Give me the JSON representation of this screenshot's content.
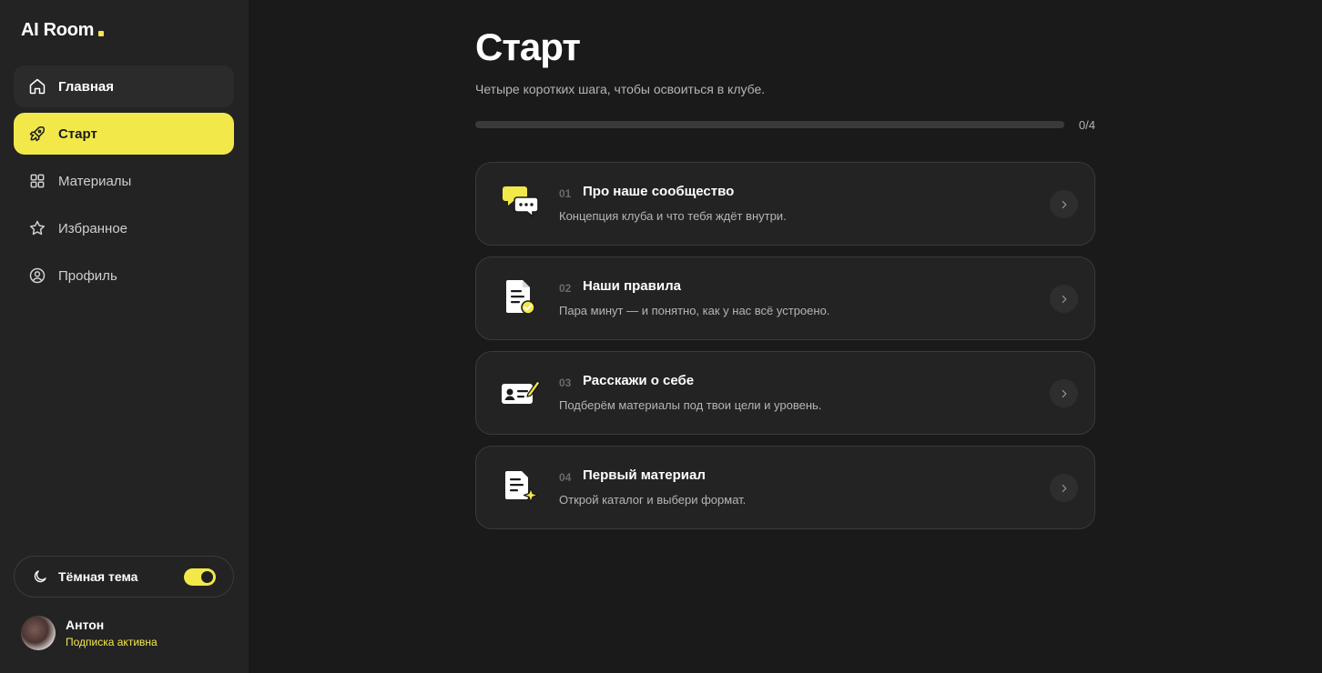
{
  "brand": {
    "name": "AI Room",
    "accent": "#f2e84a"
  },
  "sidebar": {
    "items": [
      {
        "label": "Главная",
        "icon": "home-icon"
      },
      {
        "label": "Старт",
        "icon": "rocket-icon"
      },
      {
        "label": "Материалы",
        "icon": "grid-icon"
      },
      {
        "label": "Избранное",
        "icon": "star-icon"
      },
      {
        "label": "Профиль",
        "icon": "user-circle-icon"
      }
    ],
    "theme_label": "Тёмная тема",
    "theme_on": true,
    "user": {
      "name": "Антон",
      "status": "Подписка активна"
    }
  },
  "main": {
    "title": "Старт",
    "subtitle": "Четыре коротких шага, чтобы освоиться в клубе.",
    "progress": {
      "done": 0,
      "total": 4,
      "label": "0/4"
    },
    "steps": [
      {
        "num": "01",
        "title": "Про наше сообщество",
        "desc": "Концепция клуба и что тебя ждёт внутри.",
        "icon": "chat-bubbles-icon"
      },
      {
        "num": "02",
        "title": "Наши правила",
        "desc": "Пара минут — и понятно, как у нас всё устроено.",
        "icon": "document-check-icon"
      },
      {
        "num": "03",
        "title": "Расскажи о себе",
        "desc": "Подберём материалы под твои цели и уровень.",
        "icon": "id-card-pen-icon"
      },
      {
        "num": "04",
        "title": "Первый материал",
        "desc": "Открой каталог и выбери формат.",
        "icon": "document-sparkle-icon"
      }
    ]
  }
}
